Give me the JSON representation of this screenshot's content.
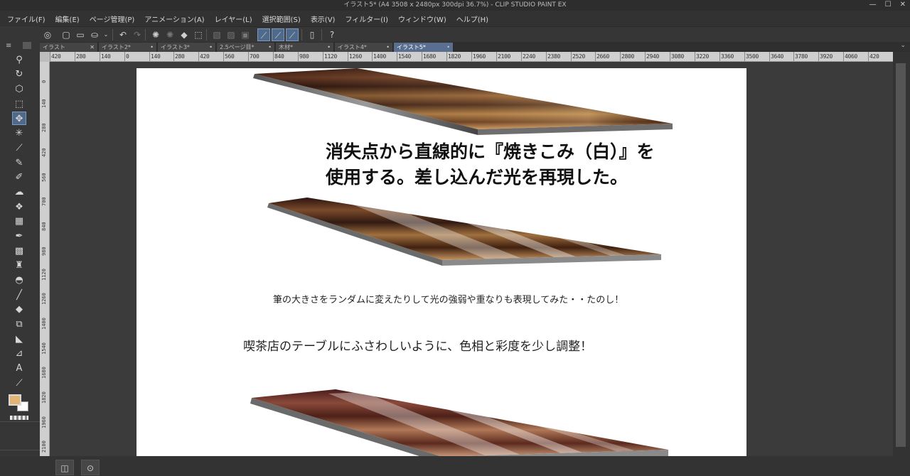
{
  "window": {
    "title": "イラスト5* (A4 3508 x 2480px 300dpi 36.7%)  - CLIP STUDIO PAINT EX",
    "minimize": "—",
    "maximize": "☐",
    "close": "✕"
  },
  "menubar": {
    "items": [
      {
        "label": "ファイル(F)"
      },
      {
        "label": "編集(E)"
      },
      {
        "label": "ページ管理(P)"
      },
      {
        "label": "アニメーション(A)"
      },
      {
        "label": "レイヤー(L)"
      },
      {
        "label": "選択範囲(S)"
      },
      {
        "label": "表示(V)"
      },
      {
        "label": "フィルター(I)"
      },
      {
        "label": "ウィンドウ(W)"
      },
      {
        "label": "ヘルプ(H)"
      }
    ]
  },
  "tabs": [
    {
      "label": "イラスト",
      "close": "✕"
    },
    {
      "label": "イラスト2*",
      "close": "•"
    },
    {
      "label": "イラスト3*",
      "close": "•"
    },
    {
      "label": "2.5ページ目*",
      "close": "•"
    },
    {
      "label": "木材*",
      "close": "•"
    },
    {
      "label": "イラスト4*",
      "close": "•"
    },
    {
      "label": "イラスト5*",
      "close": "•"
    }
  ],
  "ruler": {
    "horizontal": [
      "420",
      "280",
      "140",
      "0",
      "140",
      "280",
      "420",
      "560",
      "700",
      "840",
      "980",
      "1120",
      "1260",
      "1400",
      "1540",
      "1680",
      "1820",
      "1960",
      "2100",
      "2240",
      "2380",
      "2520",
      "2660",
      "2800",
      "2940",
      "3080",
      "3220",
      "3360",
      "3500",
      "3640",
      "3780",
      "3920",
      "4060",
      "420"
    ],
    "vertical": [
      "0",
      "140",
      "280",
      "420",
      "560",
      "700",
      "840",
      "980",
      "1120",
      "1260",
      "1400",
      "1540",
      "1680",
      "1820",
      "1960",
      "2100"
    ]
  },
  "canvas": {
    "caption_big_line1": "消失点から直線的に『焼きこみ（白）』を",
    "caption_big_line2": "使用する。差し込んだ光を再現した。",
    "caption_small": "筆の大きさをランダムに変えたりして光の強弱や重なりも表現してみた・・たのし！",
    "caption_mid": "喫茶店のテーブルにふさわしいように、色相と彩度を少し調整！"
  },
  "colors": {
    "main": "#e3b476",
    "sub": "#ffffff",
    "active_tool": "#50698a"
  }
}
